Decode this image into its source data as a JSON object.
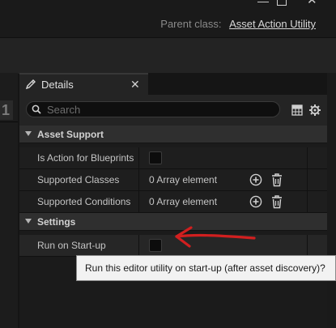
{
  "header": {
    "parent_class_label": "Parent class:",
    "parent_class_value": "Asset Action Utility"
  },
  "left_panel_fragment": "1",
  "details": {
    "tab_title": "Details",
    "search_placeholder": "Search",
    "categories": [
      {
        "label": "Asset Support",
        "properties": [
          {
            "name": "Is Action for Blueprints",
            "type": "checkbox",
            "checked": false
          },
          {
            "name": "Supported Classes",
            "type": "array",
            "value": "0 Array element"
          },
          {
            "name": "Supported Conditions",
            "type": "array",
            "value": "0 Array element"
          }
        ]
      },
      {
        "label": "Settings",
        "properties": [
          {
            "name": "Run on Start-up",
            "type": "checkbox",
            "checked": false
          }
        ]
      }
    ]
  },
  "tooltip": {
    "text": "Run this editor utility on start-up (after asset discovery)?"
  },
  "colors": {
    "annotation_arrow": "#d11f1f"
  }
}
